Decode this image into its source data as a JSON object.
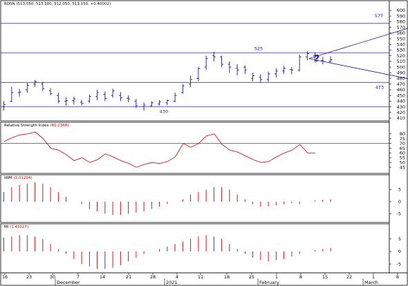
{
  "chart_data": [
    {
      "type": "ohlc",
      "title": "ROSN",
      "title_values": "(513.050, 513.300, 512.050, 513.150, +0.40002)",
      "ylim": [
        410,
        600
      ],
      "yticks": [
        "600",
        "590",
        "580",
        "570",
        "560",
        "550",
        "540",
        "530",
        "520",
        "510",
        "500",
        "490",
        "480",
        "470",
        "460",
        "450",
        "440",
        "430",
        "420",
        "410"
      ],
      "hlines": [
        {
          "value": 577,
          "label": "577"
        },
        {
          "value": 525,
          "label": "525"
        },
        {
          "value": 473,
          "label": "473"
        },
        {
          "value": 430,
          "label": "430"
        }
      ],
      "prediction_lines": {
        "from": {
          "x": 39.2,
          "y": 515
        },
        "up_to": {
          "x": 54,
          "y": 577
        },
        "down_to": {
          "x": 54,
          "y": 474
        }
      },
      "question_mark": "?",
      "bars": [
        {
          "x": 0,
          "o": 430,
          "h": 440,
          "l": 423,
          "c": 434
        },
        {
          "x": 1,
          "o": 440,
          "h": 465,
          "l": 438,
          "c": 455
        },
        {
          "x": 2,
          "o": 455,
          "h": 462,
          "l": 448,
          "c": 456
        },
        {
          "x": 3,
          "o": 460,
          "h": 472,
          "l": 455,
          "c": 468
        },
        {
          "x": 4,
          "o": 470,
          "h": 477,
          "l": 465,
          "c": 474
        },
        {
          "x": 5,
          "o": 470,
          "h": 474,
          "l": 458,
          "c": 462
        },
        {
          "x": 6,
          "o": 458,
          "h": 463,
          "l": 450,
          "c": 453
        },
        {
          "x": 7,
          "o": 450,
          "h": 455,
          "l": 436,
          "c": 440
        },
        {
          "x": 8,
          "o": 440,
          "h": 447,
          "l": 432,
          "c": 441
        },
        {
          "x": 9,
          "o": 441,
          "h": 448,
          "l": 434,
          "c": 444
        },
        {
          "x": 10,
          "o": 438,
          "h": 442,
          "l": 432,
          "c": 436
        },
        {
          "x": 11,
          "o": 440,
          "h": 452,
          "l": 437,
          "c": 448
        },
        {
          "x": 12,
          "o": 448,
          "h": 460,
          "l": 442,
          "c": 455
        },
        {
          "x": 13,
          "o": 452,
          "h": 457,
          "l": 440,
          "c": 445
        },
        {
          "x": 14,
          "o": 450,
          "h": 462,
          "l": 446,
          "c": 458
        },
        {
          "x": 15,
          "o": 450,
          "h": 456,
          "l": 440,
          "c": 446
        },
        {
          "x": 16,
          "o": 445,
          "h": 450,
          "l": 438,
          "c": 444
        },
        {
          "x": 17,
          "o": 440,
          "h": 444,
          "l": 428,
          "c": 432
        },
        {
          "x": 18,
          "o": 430,
          "h": 438,
          "l": 423,
          "c": 433
        },
        {
          "x": 19,
          "o": 432,
          "h": 440,
          "l": 430,
          "c": 437
        },
        {
          "x": 20,
          "o": 435,
          "h": 442,
          "l": 432,
          "c": 439
        },
        {
          "x": 21,
          "o": 437,
          "h": 443,
          "l": 433,
          "c": 441
        },
        {
          "x": 22,
          "o": 440,
          "h": 455,
          "l": 438,
          "c": 450
        },
        {
          "x": 23,
          "o": 455,
          "h": 470,
          "l": 453,
          "c": 467
        },
        {
          "x": 24,
          "o": 470,
          "h": 485,
          "l": 465,
          "c": 478
        },
        {
          "x": 25,
          "o": 480,
          "h": 500,
          "l": 475,
          "c": 497
        },
        {
          "x": 26,
          "o": 500,
          "h": 520,
          "l": 495,
          "c": 515
        },
        {
          "x": 27,
          "o": 520,
          "h": 527,
          "l": 510,
          "c": 518
        },
        {
          "x": 28,
          "o": 518,
          "h": 520,
          "l": 500,
          "c": 505
        },
        {
          "x": 29,
          "o": 505,
          "h": 510,
          "l": 490,
          "c": 500
        },
        {
          "x": 30,
          "o": 498,
          "h": 505,
          "l": 485,
          "c": 495
        },
        {
          "x": 31,
          "o": 500,
          "h": 503,
          "l": 488,
          "c": 495
        },
        {
          "x": 32,
          "o": 480,
          "h": 490,
          "l": 475,
          "c": 485
        },
        {
          "x": 33,
          "o": 482,
          "h": 487,
          "l": 472,
          "c": 478
        },
        {
          "x": 34,
          "o": 478,
          "h": 492,
          "l": 474,
          "c": 488
        },
        {
          "x": 35,
          "o": 488,
          "h": 498,
          "l": 482,
          "c": 493
        },
        {
          "x": 36,
          "o": 493,
          "h": 502,
          "l": 488,
          "c": 498
        },
        {
          "x": 37,
          "o": 496,
          "h": 500,
          "l": 487,
          "c": 495
        },
        {
          "x": 38,
          "o": 495,
          "h": 522,
          "l": 492,
          "c": 518
        },
        {
          "x": 39,
          "o": 518,
          "h": 528,
          "l": 512,
          "c": 524
        },
        {
          "x": 40,
          "o": 520,
          "h": 526,
          "l": 508,
          "c": 512
        },
        {
          "x": 41,
          "o": 512,
          "h": 518,
          "l": 505,
          "c": 510
        },
        {
          "x": 42,
          "o": 510,
          "h": 519,
          "l": 507,
          "c": 513
        }
      ]
    },
    {
      "type": "line",
      "title": "Relative Strength Index",
      "title_value": "(60.2368)",
      "ylim": [
        40,
        85
      ],
      "yticks": [
        "80",
        "75",
        "70",
        "65",
        "60",
        "55",
        "50",
        "45"
      ],
      "hline": 70,
      "series": [
        {
          "values": [
            72,
            76,
            79,
            80,
            82,
            75,
            65,
            63,
            58,
            52,
            55,
            50,
            53,
            59,
            56,
            52,
            49,
            45,
            48,
            50,
            49,
            51,
            56,
            70,
            66,
            70,
            78,
            80,
            69,
            63,
            61,
            57,
            53,
            50,
            51,
            56,
            60,
            63,
            69,
            60,
            60
          ]
        }
      ]
    },
    {
      "type": "bar",
      "title": "IWM",
      "title_value": "(1.01204)",
      "ylim": [
        -8,
        8
      ],
      "yticks": [
        "5",
        "0",
        "-5"
      ],
      "values": [
        4,
        6,
        7,
        7.5,
        8,
        7.5,
        6,
        4,
        2,
        0,
        -1,
        -3,
        -4,
        -5,
        -5.5,
        -5.5,
        -5,
        -4.5,
        -4,
        -3,
        -2,
        -1,
        0,
        1,
        3,
        4,
        5,
        6,
        6,
        5,
        3,
        1,
        -1,
        -2,
        -2,
        -1.5,
        -1,
        -0.5,
        -1,
        0,
        0.5,
        0.8,
        1
      ]
    },
    {
      "type": "bar",
      "title": "MI",
      "title_value": "(1.45027)",
      "ylim": [
        -8,
        8
      ],
      "yticks": [
        "5",
        "0",
        "-5"
      ],
      "values": [
        5.5,
        6,
        6.5,
        6.5,
        6,
        5,
        3,
        1,
        -1,
        -3,
        -5,
        -6,
        -7,
        -7,
        -6.5,
        -5.5,
        -4,
        -2.5,
        -1,
        0,
        1,
        2,
        3,
        4,
        5,
        6,
        6.5,
        6,
        5,
        3,
        1,
        -1,
        -2.5,
        -3.5,
        -4,
        -3.5,
        -3,
        -2,
        -1,
        0,
        0.5,
        1,
        1.4
      ]
    }
  ],
  "x_axis": {
    "ticks": [
      "16",
      "23",
      "30",
      "7",
      "14",
      "21",
      "28",
      "4",
      "11",
      "18",
      "25",
      "1",
      "8",
      "15",
      "22",
      "1",
      "8"
    ],
    "months": [
      "December",
      "2021",
      "February",
      "March"
    ]
  },
  "colors": {
    "price": "#1a1a8e",
    "hline": "#1a1a8e",
    "rsi": "#c00000",
    "hist": "#c00000",
    "value": "#c00000"
  }
}
